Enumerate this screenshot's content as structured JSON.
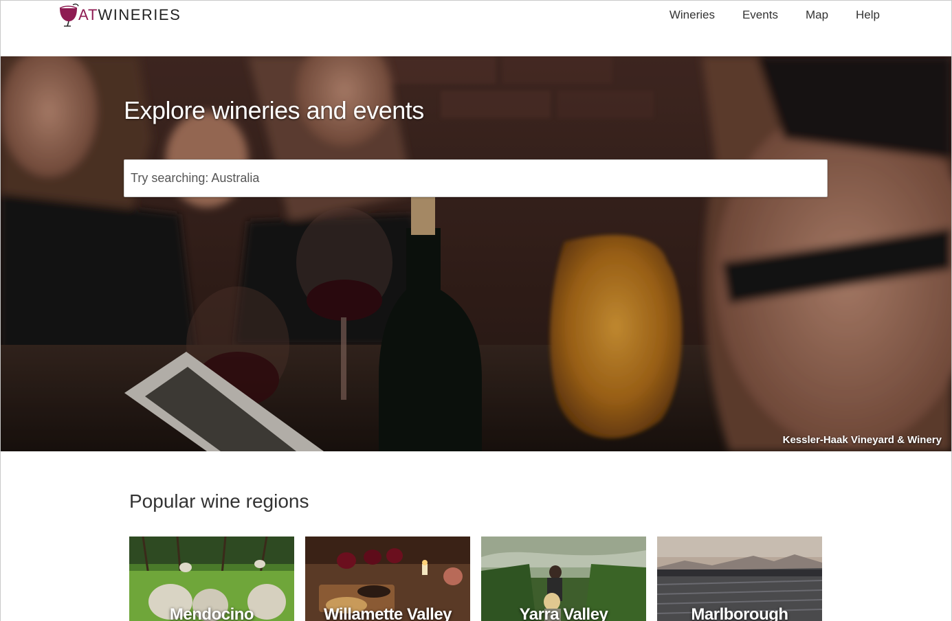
{
  "brand": {
    "prefix": "AT",
    "name": "WINERIES",
    "accent_color": "#8e1b52"
  },
  "nav": {
    "items": [
      {
        "label": "Wineries"
      },
      {
        "label": "Events"
      },
      {
        "label": "Map"
      },
      {
        "label": "Help"
      }
    ]
  },
  "hero": {
    "title": "Explore wineries and events",
    "search_placeholder": "Try searching: Australia",
    "search_value": "",
    "photo_credit": "Kessler-Haak Vineyard & Winery"
  },
  "regions": {
    "heading": "Popular wine regions",
    "items": [
      {
        "name": "Mendocino",
        "image_icon": "sheep-vineyard-photo"
      },
      {
        "name": "Willamette Valley",
        "image_icon": "wine-tasting-photo"
      },
      {
        "name": "Yarra Valley",
        "image_icon": "vineyard-walk-photo"
      },
      {
        "name": "Marlborough",
        "image_icon": "mountain-vineyard-photo"
      }
    ]
  }
}
